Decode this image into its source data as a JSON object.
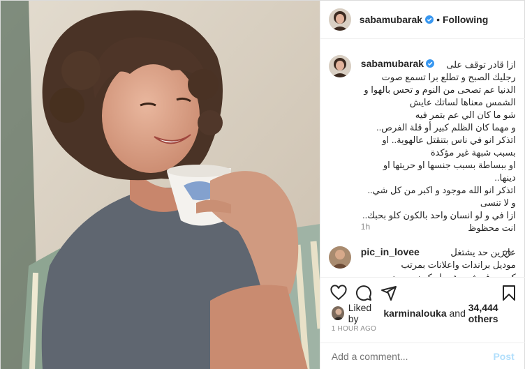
{
  "header": {
    "username": "sabamubarak",
    "separator": "•",
    "follow_status": "Following"
  },
  "caption": {
    "username": "sabamubarak",
    "lines": [
      "ازا قادر توقف على",
      "رجليك الصبح و تطلع برا تسمع صوت",
      "الدنيا عم تصحى من النوم و تحس بالهوا و",
      "الشمس معناها لساتك عايش",
      "شو ما كان الي عم بتمر فيه",
      "و مهما كان الظلم كبير أو قلة الفرص..",
      "اتذكر انو في ناس بتنقتل عالهوية.. او",
      "بسبب شبهة غير مؤكدة",
      "او ببساطة بسبب جنسها او حريتها او",
      "دينها..",
      "اتذكر انو الله موجود و اكبر من كل شي..",
      "و لا تنسى",
      "ازا في و لو انسان واحد بالكون كلو بحبك..",
      "انت محظوظ"
    ],
    "time": "1h"
  },
  "comment": {
    "username": "pic_in_lovee",
    "lines": [
      "عايزين حد يشتغل",
      "موديل براندات واعلانات بمرتب",
      "كويس ف شهر شرط يكون مصري"
    ]
  },
  "actions": {
    "like": "heart-icon",
    "comment": "comment-icon",
    "share": "share-icon",
    "save": "bookmark-icon"
  },
  "likes": {
    "prefix": "Liked by",
    "liked_by_user": "karminalouka",
    "conjunction": "and",
    "others": "34,444 others"
  },
  "timestamp": "1 HOUR AGO",
  "add_comment": {
    "placeholder": "Add a comment...",
    "post_label": "Post"
  },
  "colors": {
    "verified": "#3897f0",
    "post_disabled": "#b2dffc",
    "muted": "#8e8e8e",
    "border": "#efefef"
  }
}
